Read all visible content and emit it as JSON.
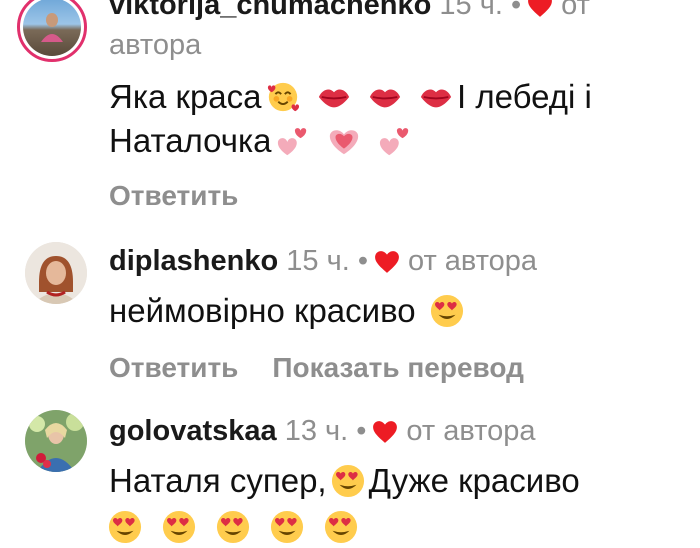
{
  "comments": [
    {
      "username": "viktorija_chumachenko",
      "time": "15 ч.",
      "separator": "•",
      "author_label": "от",
      "author_label2": "автора",
      "text_line1": "Яка краса",
      "text_line1_tail": "І лебеді і",
      "text_line2": "Наталочка",
      "reply": "Ответить"
    },
    {
      "username": "diplashenko",
      "time": "15 ч.",
      "separator": "•",
      "author_label": "от автора",
      "text": "неймовірно красиво",
      "reply": "Ответить",
      "translate": "Показать перевод"
    },
    {
      "username": "golovatskaa",
      "time": "13 ч.",
      "separator": "•",
      "author_label": "от автора",
      "text_part1": "Наталя супер,",
      "text_part2": "Дуже красиво"
    }
  ],
  "icons": {
    "liked_heart": "heart-icon",
    "emoji_smiling_hearts": "smiling-face-with-hearts-icon",
    "emoji_kiss_lips": "kiss-mark-icon",
    "emoji_two_hearts": "two-hearts-icon",
    "emoji_heart_eyes": "heart-eyes-icon"
  },
  "colors": {
    "like_red": "#ed1c24",
    "muted": "#8e8e8e",
    "story_ring": "#e1306c"
  }
}
